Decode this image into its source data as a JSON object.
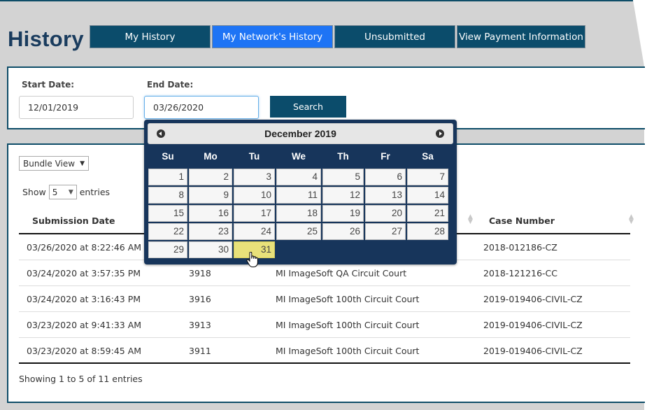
{
  "page": {
    "title": "History"
  },
  "tabs": [
    {
      "label": "My History",
      "active": false
    },
    {
      "label": "My Network's History",
      "active": true
    },
    {
      "label": "Unsubmitted",
      "active": false
    },
    {
      "label": "View Payment Information",
      "active": false
    }
  ],
  "colors": {
    "primary": "#0b4c6b",
    "active_tab": "#1e74f5",
    "calendar_bg": "#17355b",
    "highlight_day": "#e8e17a",
    "page_bg": "#d3d3d3"
  },
  "search": {
    "start_label": "Start Date:",
    "start_value": "12/01/2019",
    "end_label": "End Date:",
    "end_value": "03/26/2020",
    "button_label": "Search"
  },
  "datepicker": {
    "month_label": "December 2019",
    "prev_icon": "circle-triangle-left-icon",
    "next_icon": "circle-triangle-right-icon",
    "weekdays": [
      "Su",
      "Mo",
      "Tu",
      "We",
      "Th",
      "Fr",
      "Sa"
    ],
    "weeks": [
      [
        "1",
        "2",
        "3",
        "4",
        "5",
        "6",
        "7"
      ],
      [
        "8",
        "9",
        "10",
        "11",
        "12",
        "13",
        "14"
      ],
      [
        "15",
        "16",
        "17",
        "18",
        "19",
        "20",
        "21"
      ],
      [
        "22",
        "23",
        "24",
        "25",
        "26",
        "27",
        "28"
      ],
      [
        "29",
        "30",
        "31",
        "",
        "",
        "",
        ""
      ]
    ],
    "highlighted_day": "31"
  },
  "results": {
    "view_select": "Bundle View",
    "show_label": "Show",
    "entries_value": "5",
    "entries_label": "entries",
    "columns": [
      "Submission Date",
      "",
      "",
      "Case Number"
    ],
    "rows": [
      [
        "03/26/2020 at 8:22:46 AM",
        "",
        "",
        "2018-012186-CZ"
      ],
      [
        "03/24/2020 at 3:57:35 PM",
        "3918",
        "MI ImageSoft QA Circuit Court",
        "2018-121216-CC"
      ],
      [
        "03/24/2020 at 3:16:43 PM",
        "3916",
        "MI ImageSoft 100th Circuit Court",
        "2019-019406-CIVIL-CZ"
      ],
      [
        "03/23/2020 at 9:41:33 AM",
        "3913",
        "MI ImageSoft 100th Circuit Court",
        "2019-019406-CIVIL-CZ"
      ],
      [
        "03/23/2020 at 8:59:45 AM",
        "3911",
        "MI ImageSoft 100th Circuit Court",
        "2019-019406-CIVIL-CZ"
      ]
    ],
    "info": "Showing 1 to 5 of 11 entries"
  }
}
